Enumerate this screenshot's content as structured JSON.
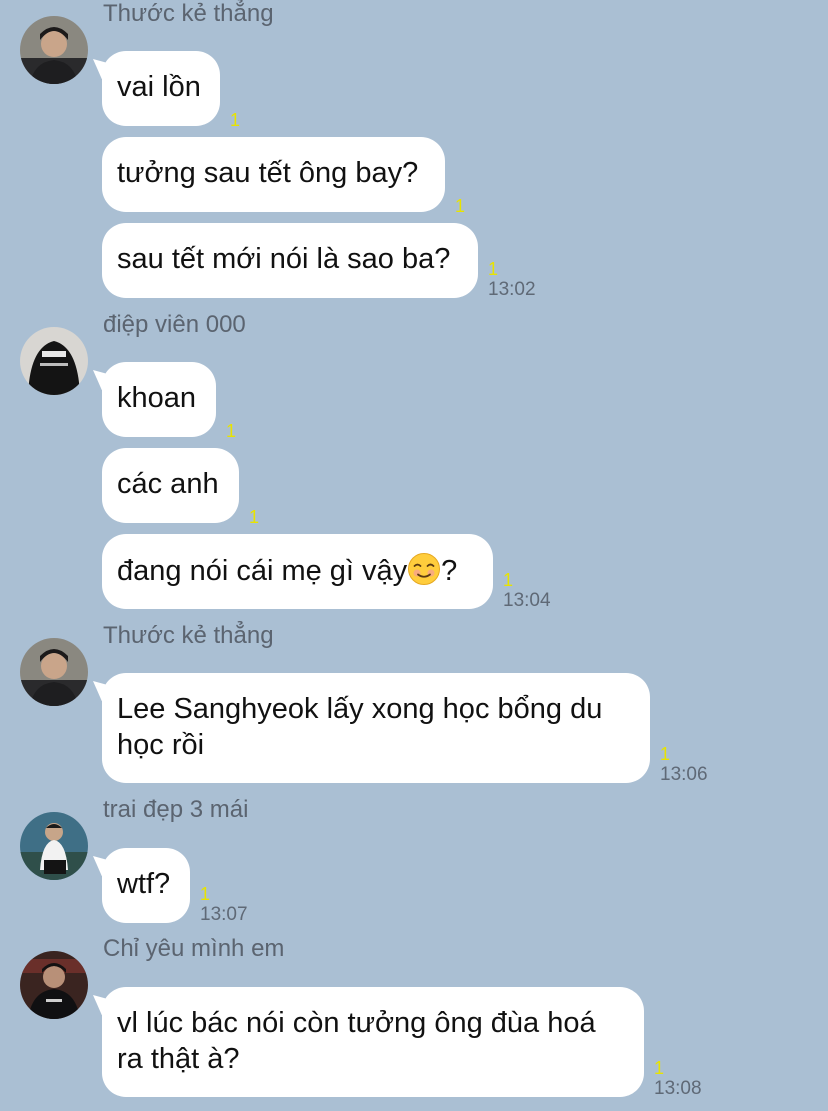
{
  "chat": {
    "groups": [
      {
        "sender": "Thước kẻ thẳng",
        "avatar": "person-photo-avatar",
        "messages": [
          {
            "text": "vai lồn",
            "read": "1"
          },
          {
            "text": "tưởng sau tết ông bay?",
            "read": "1"
          },
          {
            "text": "sau tết mới nói là sao ba?",
            "read": "1",
            "time": "13:02"
          }
        ]
      },
      {
        "sender": "điệp viên 000",
        "avatar": "person-photo-avatar",
        "messages": [
          {
            "text": "khoan",
            "read": "1"
          },
          {
            "text": "các anh",
            "read": "1"
          },
          {
            "text_before_emoji": "đang nói cái mẹ gì vậy",
            "emoji": "smiling-face-emoji",
            "text_after_emoji": "?",
            "read": "1",
            "time": "13:04"
          }
        ]
      },
      {
        "sender": "Thước kẻ thẳng",
        "avatar": "person-photo-avatar",
        "messages": [
          {
            "line1": "Lee Sanghyeok lấy xong học bổng du",
            "line2": "học rồi",
            "read": "1",
            "time": "13:06"
          }
        ]
      },
      {
        "sender": "trai đẹp 3 mái",
        "avatar": "person-photo-avatar",
        "messages": [
          {
            "text": "wtf?",
            "read": "1",
            "time": "13:07"
          }
        ]
      },
      {
        "sender": "Chỉ yêu mình em",
        "avatar": "person-photo-avatar",
        "messages": [
          {
            "line1": "vl lúc bác nói còn tưởng ông đùa hoá",
            "line2": "ra thật à?",
            "read": "1",
            "time": "13:08"
          }
        ]
      }
    ]
  },
  "colors": {
    "background": "#aabfd3",
    "bubble": "#ffffff",
    "read_indicator": "#e8e300",
    "timestamp": "#5f6976",
    "sender_name": "#5b6470"
  }
}
